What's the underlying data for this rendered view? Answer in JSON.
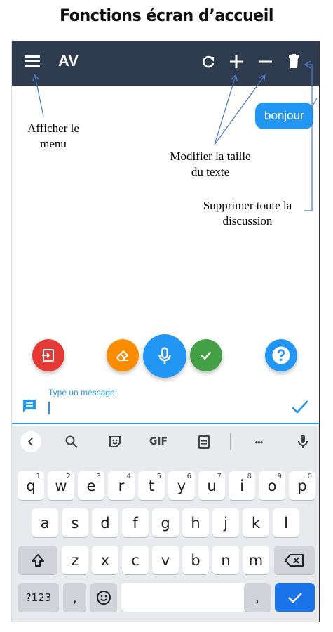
{
  "page_title": "Fonctions écran d’accueil",
  "app": {
    "title": "AV"
  },
  "chat": {
    "messages": [
      {
        "text": "bonjour",
        "from": "user"
      }
    ]
  },
  "annotations": {
    "menu": [
      "Afficher le",
      "menu"
    ],
    "text_size": [
      "Modifier la taille",
      "du texte"
    ],
    "delete": [
      "Supprimer toute la",
      "discussion"
    ]
  },
  "input": {
    "label": "Type un message:",
    "value": ""
  },
  "fabs": [
    {
      "name": "exit-fab",
      "icon": "exit-icon",
      "color": "#e53935"
    },
    {
      "name": "eraser-fab",
      "icon": "eraser-icon",
      "color": "#fb8c00"
    },
    {
      "name": "mic-fab",
      "icon": "microphone-icon",
      "color": "#2196f3"
    },
    {
      "name": "validate-fab",
      "icon": "check-icon",
      "color": "#43a047"
    },
    {
      "name": "help-fab",
      "icon": "help-icon",
      "color": "#2196f3"
    }
  ],
  "keyboard": {
    "toolbar": {
      "gif": "GIF",
      "more": "•••"
    },
    "row1": [
      {
        "k": "q",
        "n": "1"
      },
      {
        "k": "w",
        "n": "2"
      },
      {
        "k": "e",
        "n": "3"
      },
      {
        "k": "r",
        "n": "4"
      },
      {
        "k": "t",
        "n": "5"
      },
      {
        "k": "y",
        "n": "6"
      },
      {
        "k": "u",
        "n": "7"
      },
      {
        "k": "i",
        "n": "8"
      },
      {
        "k": "o",
        "n": "9"
      },
      {
        "k": "p",
        "n": "0"
      }
    ],
    "row2": [
      "a",
      "s",
      "d",
      "f",
      "g",
      "h",
      "j",
      "k",
      "l"
    ],
    "row3": [
      "z",
      "x",
      "c",
      "v",
      "b",
      "n",
      "m"
    ],
    "bottom": {
      "symbols": "?123",
      "comma": ",",
      "period": "."
    }
  },
  "colors": {
    "appbar": "#2f3c4f",
    "accent": "#2196f3",
    "keyboard_bg": "#e8eaed"
  }
}
